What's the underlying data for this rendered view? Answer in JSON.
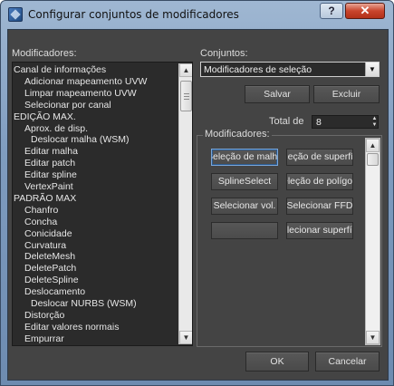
{
  "window": {
    "title": "Configurar conjuntos de modificadores",
    "help_label": "?",
    "close_label": "✕"
  },
  "left": {
    "label": "Modificadores:",
    "items": [
      {
        "text": "Canal de informações",
        "indent": 0
      },
      {
        "text": "Adicionar mapeamento UVW",
        "indent": 1
      },
      {
        "text": "Limpar mapeamento UVW",
        "indent": 1
      },
      {
        "text": "Selecionar por canal",
        "indent": 1
      },
      {
        "text": "EDIÇÃO MAX.",
        "indent": 0
      },
      {
        "text": "Aprox. de disp.",
        "indent": 1
      },
      {
        "text": "Deslocar malha (WSM)",
        "indent": 2
      },
      {
        "text": "Editar malha",
        "indent": 1
      },
      {
        "text": "Editar patch",
        "indent": 1
      },
      {
        "text": "Editar spline",
        "indent": 1
      },
      {
        "text": "VertexPaint",
        "indent": 1
      },
      {
        "text": "PADRÃO MAX",
        "indent": 0
      },
      {
        "text": "Chanfro",
        "indent": 1
      },
      {
        "text": "Concha",
        "indent": 1
      },
      {
        "text": "Conicidade",
        "indent": 1
      },
      {
        "text": "Curvatura",
        "indent": 1
      },
      {
        "text": "DeleteMesh",
        "indent": 1
      },
      {
        "text": "DeletePatch",
        "indent": 1
      },
      {
        "text": "DeleteSpline",
        "indent": 1
      },
      {
        "text": "Deslocamento",
        "indent": 1
      },
      {
        "text": "Deslocar NURBS (WSM)",
        "indent": 2
      },
      {
        "text": "Distorção",
        "indent": 1
      },
      {
        "text": "Editar valores normais",
        "indent": 1
      },
      {
        "text": "Empurrar",
        "indent": 1
      }
    ]
  },
  "right": {
    "sets_label": "Conjuntos:",
    "sets_value": "Modificadores de seleção",
    "save_label": "Salvar",
    "delete_label": "Excluir",
    "total_label": "Total de",
    "total_value": "8",
    "group_label": "Modificadores:",
    "buttons": [
      {
        "text": "Seleção de malha",
        "selected": true
      },
      {
        "text": "Seleção de superfície",
        "selected": false
      },
      {
        "text": "SplineSelect",
        "selected": false
      },
      {
        "text": "Seleção de polígono",
        "selected": false
      },
      {
        "text": "Selecionar vol.",
        "selected": false
      },
      {
        "text": "Selecionar FFD",
        "selected": false
      },
      {
        "text": "",
        "selected": false
      },
      {
        "text": "Selecionar superfície",
        "selected": false
      }
    ]
  },
  "footer": {
    "ok_label": "OK",
    "cancel_label": "Cancelar"
  },
  "icons": {
    "window": "app-icon",
    "dropdown": "chevron-down-icon",
    "scroll_up": "arrow-up-icon",
    "scroll_down": "arrow-down-icon"
  },
  "colors": {
    "panel_bg": "#444444",
    "list_bg": "#2b2b2b",
    "selection_outline": "#7aa7d9",
    "title_close": "#c9452d"
  }
}
